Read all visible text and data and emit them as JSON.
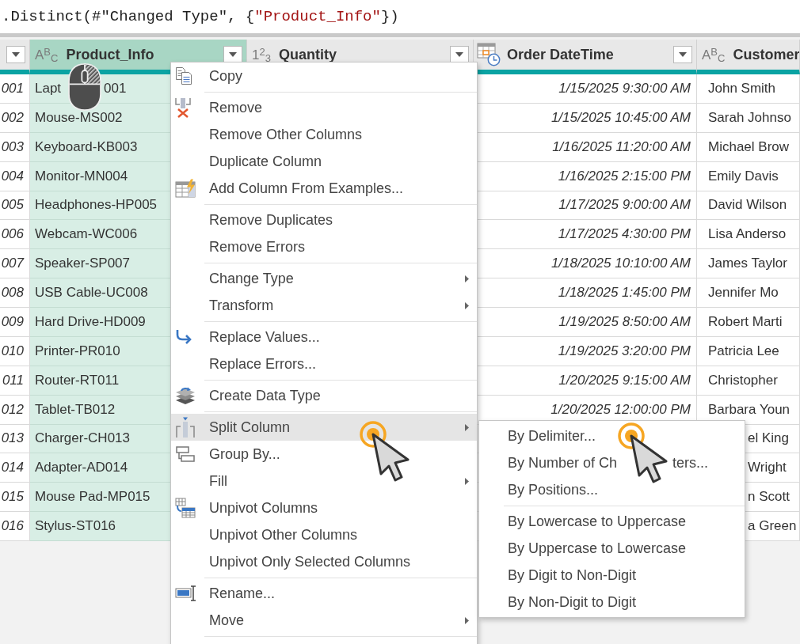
{
  "formula_bar": {
    "parts": [
      {
        "kind": "code",
        "text": ".Distinct(#\"Changed Type\", {"
      },
      {
        "kind": "string",
        "text": "\"Product_Info\""
      },
      {
        "kind": "code",
        "text": "})"
      }
    ]
  },
  "table": {
    "columns": [
      {
        "kind": "unknown",
        "selected": false,
        "filter_button": true
      },
      {
        "kind": "text",
        "type_label": "A$^{B}$$_{C}$",
        "label": "Product_Info",
        "selected": true,
        "filter_button": true
      },
      {
        "kind": "number",
        "type_label": "1$^{2}$$_{3}$",
        "label": "Quantity",
        "selected": false,
        "filter_button": true
      },
      {
        "kind": "datetime",
        "label": "Order DateTime",
        "selected": false,
        "filter_button": true
      },
      {
        "kind": "text",
        "type_label": "A$^{B}$$_{C}$",
        "label": "Customer",
        "selected": false
      }
    ],
    "rows": [
      {
        "column_1": "001",
        "product_info": "Lapt",
        "product_info_tail": "001",
        "order_datetime": "1/15/2025 9:30:00 AM",
        "customer": "John Smith"
      },
      {
        "column_1": "002",
        "product_info": "Mouse-MS002",
        "order_datetime": "1/15/2025 10:45:00 AM",
        "customer": "Sarah Johnso"
      },
      {
        "column_1": "003",
        "product_info": "Keyboard-KB003",
        "order_datetime": "1/16/2025 11:20:00 AM",
        "customer": "Michael Brow"
      },
      {
        "column_1": "004",
        "product_info": "Monitor-MN004",
        "order_datetime": "1/16/2025 2:15:00 PM",
        "customer": "Emily Davis"
      },
      {
        "column_1": "005",
        "product_info": "Headphones-HP005",
        "order_datetime": "1/17/2025 9:00:00 AM",
        "customer": "David Wilson"
      },
      {
        "column_1": "006",
        "product_info": "Webcam-WC006",
        "order_datetime": "1/17/2025 4:30:00 PM",
        "customer": "Lisa Anderso"
      },
      {
        "column_1": "007",
        "product_info": "Speaker-SP007",
        "order_datetime": "1/18/2025 10:10:00 AM",
        "customer": "James Taylor"
      },
      {
        "column_1": "008",
        "product_info": "USB Cable-UC008",
        "order_datetime": "1/18/2025 1:45:00 PM",
        "customer": "Jennifer Mo"
      },
      {
        "column_1": "009",
        "product_info": "Hard Drive-HD009",
        "order_datetime": "1/19/2025 8:50:00 AM",
        "customer": "Robert Marti"
      },
      {
        "column_1": "010",
        "product_info": "Printer-PR010",
        "order_datetime": "1/19/2025 3:20:00 PM",
        "customer": "Patricia Lee"
      },
      {
        "column_1": "011",
        "product_info": "Router-RT011",
        "order_datetime": "1/20/2025 9:15:00 AM",
        "customer": "Christopher"
      },
      {
        "column_1": "012",
        "product_info": "Tablet-TB012",
        "order_datetime": "1/20/2025 12:00:00 PM",
        "customer": "Barbara Youn"
      },
      {
        "column_1": "013",
        "product_info": "Charger-CH013",
        "customer": "el King"
      },
      {
        "column_1": "014",
        "product_info": "Adapter-AD014",
        "customer": "Wright"
      },
      {
        "column_1": "015",
        "product_info": "Mouse Pad-MP015",
        "customer": "n Scott"
      },
      {
        "column_1": "016",
        "product_info": "Stylus-ST016",
        "customer": "a Green"
      }
    ]
  },
  "context_menu": {
    "groups": [
      {
        "items": [
          {
            "label": "Copy",
            "has_submenu": false,
            "selected": false
          }
        ]
      },
      {
        "items": [
          {
            "label": "Remove",
            "has_submenu": false,
            "selected": false
          },
          {
            "label": "Remove Other Columns",
            "has_submenu": false,
            "selected": false
          },
          {
            "label": "Duplicate Column",
            "has_submenu": false,
            "selected": false
          },
          {
            "label": "Add Column From Examples...",
            "has_submenu": false,
            "selected": false
          }
        ]
      },
      {
        "items": [
          {
            "label": "Remove Duplicates",
            "has_submenu": false,
            "selected": false
          },
          {
            "label": "Remove Errors",
            "has_submenu": false,
            "selected": false
          }
        ]
      },
      {
        "items": [
          {
            "label": "Change Type",
            "has_submenu": true,
            "selected": false
          },
          {
            "label": "Transform",
            "has_submenu": true,
            "selected": false
          }
        ]
      },
      {
        "items": [
          {
            "label": "Replace Values...",
            "has_submenu": false,
            "selected": false
          },
          {
            "label": "Replace Errors...",
            "has_submenu": false,
            "selected": false
          }
        ]
      },
      {
        "items": [
          {
            "label": "Create Data Type",
            "has_submenu": false,
            "selected": false
          }
        ]
      },
      {
        "items": [
          {
            "label": "Split Column",
            "has_submenu": true,
            "selected": true,
            "submenu": {
              "groups": [
                {
                  "items": [
                    {
                      "label": "By Delimiter...",
                      "selected": false
                    },
                    {
                      "label": "By Number of Ch",
                      "label_tail": "ters...",
                      "selected": false
                    },
                    {
                      "label": "By Positions...",
                      "selected": false
                    }
                  ]
                },
                {
                  "items": [
                    {
                      "label": "By Lowercase to Uppercase",
                      "selected": false
                    },
                    {
                      "label": "By Uppercase to Lowercase",
                      "selected": false
                    },
                    {
                      "label": "By Digit to Non-Digit",
                      "selected": false
                    },
                    {
                      "label": "By Non-Digit to Digit",
                      "selected": false
                    }
                  ]
                }
              ]
            }
          },
          {
            "label": "Group By...",
            "has_submenu": false,
            "selected": false
          },
          {
            "label": "Fill",
            "has_submenu": true,
            "selected": false
          },
          {
            "label": "Unpivot Columns",
            "has_submenu": false,
            "selected": false
          },
          {
            "label": "Unpivot Other Columns",
            "has_submenu": false,
            "selected": false
          },
          {
            "label": "Unpivot Only Selected Columns",
            "has_submenu": false,
            "selected": false
          }
        ]
      },
      {
        "items": [
          {
            "label": "Rename...",
            "has_submenu": false,
            "selected": false
          },
          {
            "label": "Move",
            "has_submenu": true,
            "selected": false
          }
        ]
      }
    ]
  }
}
